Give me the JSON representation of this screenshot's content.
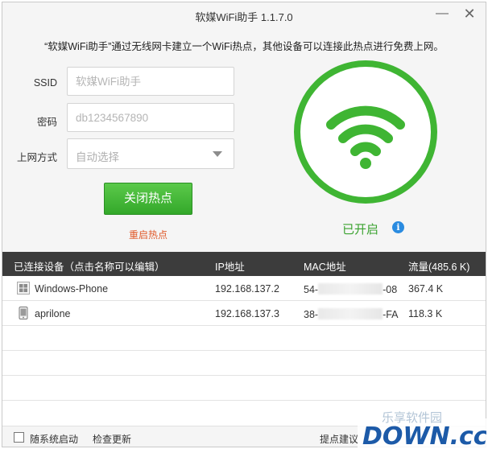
{
  "window": {
    "title": "软媒WiFi助手 1.1.7.0",
    "minimize_glyph": "—",
    "close_glyph": "✕"
  },
  "subtitle": "“软媒WiFi助手”通过无线网卡建立一个WiFi热点，其他设备可以连接此热点进行免费上网。",
  "form": {
    "ssid_label": "SSID",
    "ssid_placeholder": "软媒WiFi助手",
    "password_label": "密码",
    "password_placeholder": "db1234567890",
    "mode_label": "上网方式",
    "mode_value": "自动选择"
  },
  "actions": {
    "toggle_hotspot": "关闭热点",
    "restart_hotspot": "重启热点"
  },
  "status": {
    "text": "已开启",
    "info_glyph": "i"
  },
  "table": {
    "headers": {
      "device": "已连接设备（点击名称可以编辑）",
      "ip": "IP地址",
      "mac": "MAC地址",
      "traffic": "流量(485.6 K)"
    },
    "rows": [
      {
        "icon": "windows-icon",
        "name": "Windows-Phone",
        "ip": "192.168.137.2",
        "mac_prefix": "54-",
        "mac_suffix": "-08",
        "traffic": "367.4 K"
      },
      {
        "icon": "phone-icon",
        "name": "aprilone",
        "ip": "192.168.137.3",
        "mac_prefix": "38-",
        "mac_suffix": "-FA",
        "traffic": "118.3 K"
      }
    ]
  },
  "footer": {
    "autostart": "随系统启动",
    "check_update": "检查更新",
    "feedback": "提点建议"
  },
  "watermark": {
    "text": "DOWN.cc",
    "text_overlay": "乐享软件园"
  },
  "colors": {
    "accent_green": "#3fb533",
    "restart_orange": "#e05a2b",
    "info_blue": "#2a8be0",
    "header_dark": "#3c3c3c"
  }
}
